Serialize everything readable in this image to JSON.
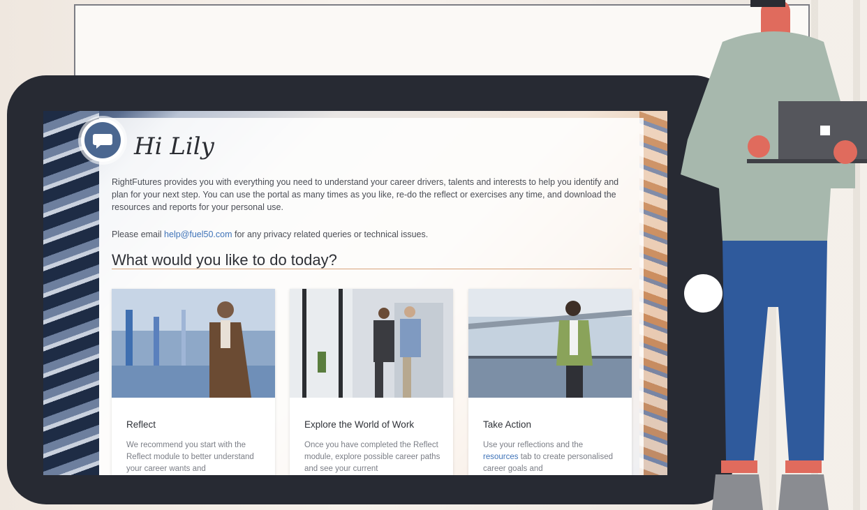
{
  "greeting": "Hi Lily",
  "intro": "RightFutures provides you with everything you need to understand your career drivers, talents and interests to help you identify and plan for your next step. You can use the portal as many times as you like, re-do the reflect or exercises any time, and download the resources and reports for your personal use.",
  "contact": {
    "prefix": "Please email ",
    "email": "help@fuel50.com",
    "suffix": " for any privacy related queries or technical issues."
  },
  "headline": "What would you like to do today?",
  "cards": [
    {
      "title": "Reflect",
      "desc": "We recommend you start with the Reflect module to better understand your career wants and"
    },
    {
      "title": "Explore the World of Work",
      "desc": "Once you have completed the Reflect module, explore possible career paths and see your current"
    },
    {
      "title": "Take Action",
      "desc_prefix": "Use your reflections and the ",
      "desc_link": "resources",
      "desc_suffix": " tab to create personalised career goals and"
    }
  ],
  "icons": {
    "chat": "chat-bubble-icon"
  },
  "colors": {
    "tablet": "#272a33",
    "accent_blue": "#4b6790",
    "link": "#3f73b8",
    "rule": "#d8a37a"
  }
}
